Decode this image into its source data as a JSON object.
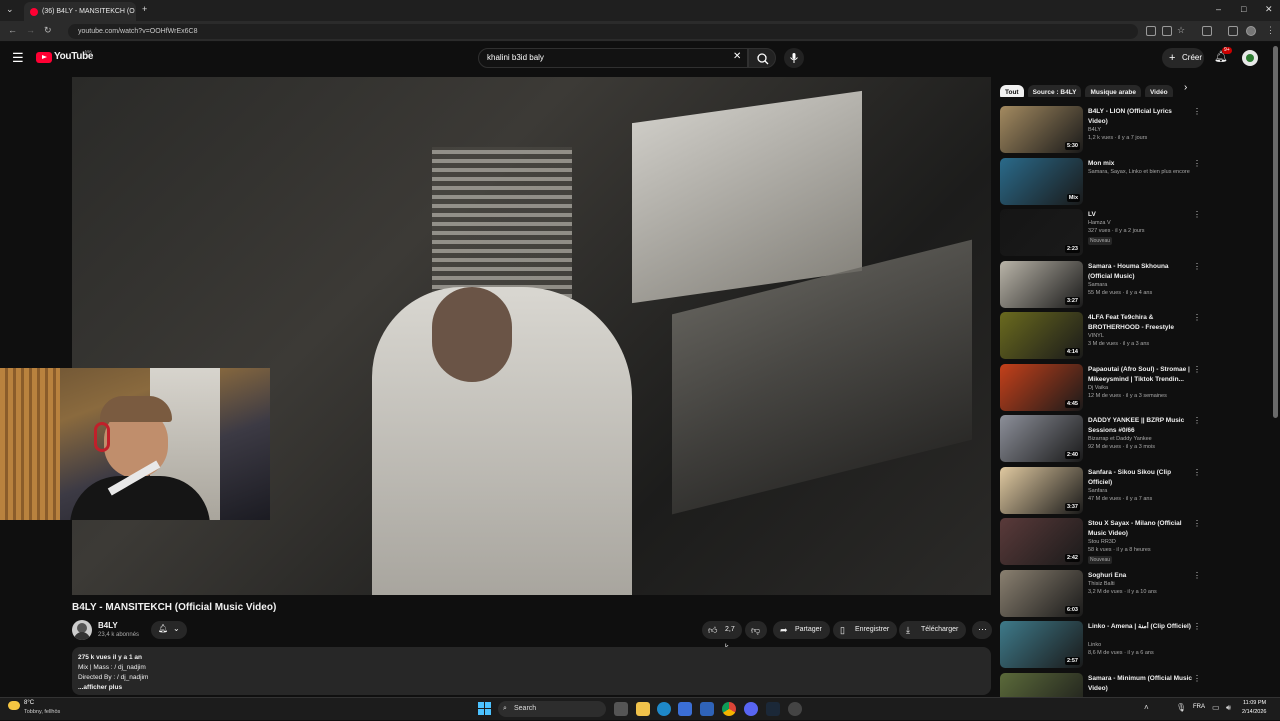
{
  "browser": {
    "tab_title": "(36) B4LY - MANSITEKCH (O",
    "new_tab": "+",
    "url": "youtube.com/watch?v=OOHfWrEx6C8",
    "window_controls": [
      "–",
      "□",
      "✕"
    ]
  },
  "header": {
    "logo_text": "YouTube",
    "logo_region": "MA",
    "search_value": "khalini b3id  baly",
    "create_label": "Créer",
    "notifications_badge": "9+"
  },
  "video": {
    "title": "B4LY - MANSITEKCH (Official Music Video)",
    "channel": "B4LY",
    "subscribers": "23,4 k abonnés",
    "likes": "2,7 k",
    "actions": {
      "share": "Partager",
      "save": "Enregistrer",
      "download": "Télécharger"
    },
    "description": {
      "stats": "275 k vues  il y a 1 an",
      "line1": "Mix | Mass :  / dj_nadjim",
      "line2": "Directed By :  / dj_nadjim",
      "more": "...afficher plus"
    }
  },
  "sidebar": {
    "chips": [
      "Tout",
      "Source : B4LY",
      "Musique arabe",
      "Vidéo"
    ],
    "items": [
      {
        "title": "B4LY - LION (Official Lyrics Video)",
        "channel": "B4LY",
        "meta": "1,2 k vues · il y a 7 jours",
        "badge": "",
        "duration": "5:30",
        "color": "#a38a60"
      },
      {
        "title": "Mon mix",
        "channel": "Samara, Sayax, Linko et bien plus encore",
        "meta": "",
        "badge": "",
        "duration": "Mix",
        "color": "#2a6a8a"
      },
      {
        "title": "LV",
        "channel": "Hamza V",
        "meta": "327 vues · il y a 2 jours",
        "badge": "Nouveau",
        "duration": "2:23",
        "color": "#151515"
      },
      {
        "title": "Samara - Houma Skhouna (Official Music)",
        "channel": "Samara",
        "meta": "55 M de vues · il y a 4 ans",
        "badge": "",
        "duration": "3:27",
        "color": "#b9b4a8"
      },
      {
        "title": "4LFA Feat Te9chira & BROTHERHOOD - Freestyle",
        "channel": "VINYL",
        "meta": "3 M de vues · il y a 3 ans",
        "badge": "",
        "duration": "4:14",
        "color": "#6a6a1e"
      },
      {
        "title": "Papaoutai (Afro Soul) - Stromae | Mikeeysmind | Tiktok Trendin...",
        "channel": "Dj Vaika",
        "meta": "12 M de vues · il y a 3 semaines",
        "badge": "",
        "duration": "4:45",
        "color": "#c4401a"
      },
      {
        "title": "DADDY YANKEE || BZRP Music Sessions #0/66",
        "channel": "Bizarrap et Daddy Yankee",
        "meta": "92 M de vues · il y a 3 mois",
        "badge": "",
        "duration": "2:40",
        "color": "#8c8f99"
      },
      {
        "title": "Sanfara - Sikou Sikou (Clip Officiel)",
        "channel": "Sanfara",
        "meta": "47 M de vues · il y a 7 ans",
        "badge": "",
        "duration": "3:37",
        "color": "#e0c9a0"
      },
      {
        "title": "Stou X Sayax - Milano (Official Music Video)",
        "channel": "Stou RR3D",
        "meta": "58 k vues · il y a 8 heures",
        "badge": "Nouveau",
        "duration": "2:42",
        "color": "#5a3a3a"
      },
      {
        "title": "Soghuri Ena",
        "channel": "Thisiz Balti",
        "meta": "3,2 M de vues · il y a 10 ans",
        "badge": "",
        "duration": "6:03",
        "color": "#8a8070"
      },
      {
        "title": "Linko - Amena | أمنة (Clip Officiel)",
        "channel": "Linko",
        "meta": "8,6 M de vues · il y a 6 ans",
        "badge": "",
        "duration": "2:57",
        "color": "#3e7a8a"
      },
      {
        "title": "Samara - Minimum (Official Music Video)",
        "channel": "",
        "meta": "",
        "badge": "",
        "duration": "",
        "color": "#5b6a3a"
      }
    ]
  },
  "taskbar": {
    "weather_temp": "8°C",
    "weather_label": "Tobbny, fellhös",
    "search_label": "Search",
    "language": "FRA",
    "time": "11:09 PM",
    "date": "2/14/2026"
  },
  "colors": {
    "yt_red": "#ff0033",
    "bg": "#0f0f0f",
    "chip_bg": "#272727"
  }
}
